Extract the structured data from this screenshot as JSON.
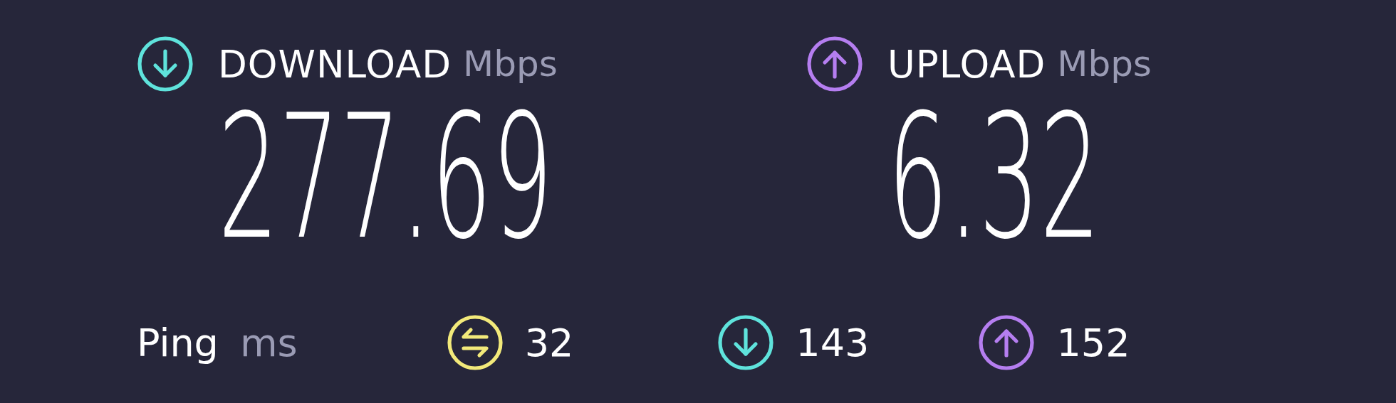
{
  "results": [
    {
      "kind": "download",
      "label": "DOWNLOAD",
      "unit": "Mbps",
      "value": "277.69",
      "color": "#5fe3dc"
    },
    {
      "kind": "upload",
      "label": "UPLOAD",
      "unit": "Mbps",
      "value": "6.32",
      "color": "#b57ef0"
    }
  ],
  "ping": {
    "label": "Ping",
    "unit": "ms",
    "items": [
      {
        "kind": "jitter",
        "value": "32",
        "color": "#f2e97a"
      },
      {
        "kind": "download",
        "value": "143",
        "color": "#5fe3dc"
      },
      {
        "kind": "upload",
        "value": "152",
        "color": "#b57ef0"
      }
    ]
  }
}
